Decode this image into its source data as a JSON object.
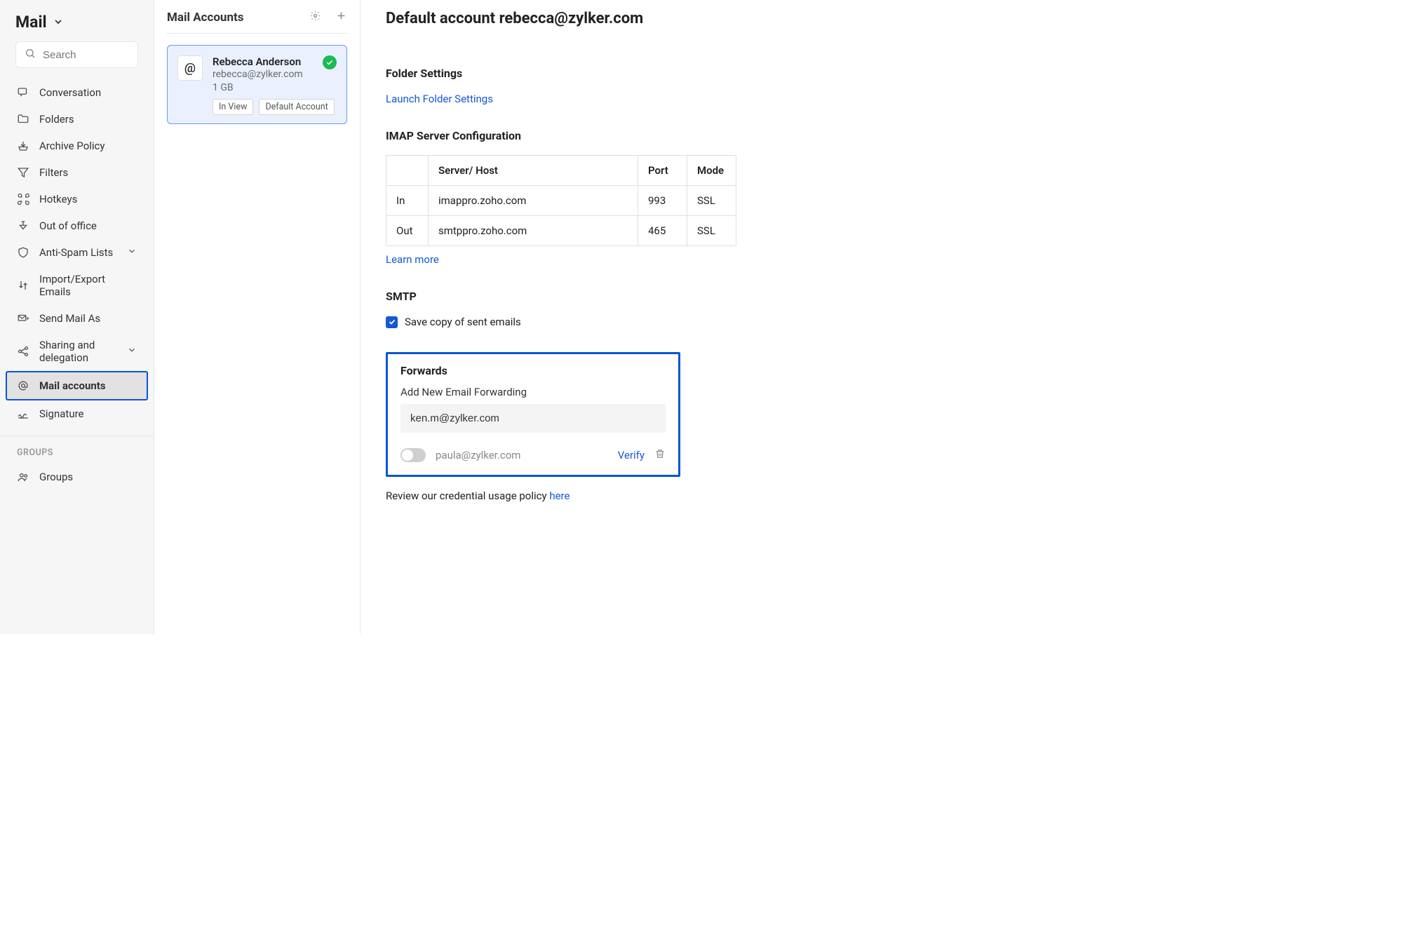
{
  "sidebar": {
    "appTitle": "Mail",
    "searchPlaceholder": "Search",
    "items": [
      {
        "label": "Conversation",
        "icon": "conversation-icon"
      },
      {
        "label": "Folders",
        "icon": "folder-icon"
      },
      {
        "label": "Archive Policy",
        "icon": "archive-icon"
      },
      {
        "label": "Filters",
        "icon": "filter-icon"
      },
      {
        "label": "Hotkeys",
        "icon": "hotkeys-icon"
      },
      {
        "label": "Out of office",
        "icon": "out-of-office-icon"
      },
      {
        "label": "Anti-Spam Lists",
        "icon": "shield-icon",
        "expandable": true
      },
      {
        "label": "Import/Export Emails",
        "icon": "import-export-icon"
      },
      {
        "label": "Send Mail As",
        "icon": "send-as-icon"
      },
      {
        "label": "Sharing and delegation",
        "icon": "share-icon",
        "expandable": true
      },
      {
        "label": "Mail accounts",
        "icon": "at-icon",
        "active": true
      },
      {
        "label": "Signature",
        "icon": "signature-icon"
      }
    ],
    "groupsHeader": "GROUPS",
    "groups": [
      {
        "label": "Groups",
        "icon": "groups-icon"
      }
    ]
  },
  "middle": {
    "title": "Mail Accounts",
    "account": {
      "name": "Rebecca Anderson",
      "email": "rebecca@zylker.com",
      "storage": "1 GB",
      "badges": [
        "In View",
        "Default Account"
      ],
      "verified": true
    }
  },
  "detail": {
    "title": "Default account rebecca@zylker.com",
    "folderSettings": {
      "heading": "Folder Settings",
      "link": "Launch Folder Settings"
    },
    "imap": {
      "heading": "IMAP Server Configuration",
      "headers": [
        "",
        "Server/ Host",
        "Port",
        "Mode"
      ],
      "rows": [
        {
          "dir": "In",
          "host": "imappro.zoho.com",
          "port": "993",
          "mode": "SSL"
        },
        {
          "dir": "Out",
          "host": "smtppro.zoho.com",
          "port": "465",
          "mode": "SSL"
        }
      ],
      "learnMore": "Learn more"
    },
    "smtp": {
      "heading": "SMTP",
      "saveCopy": "Save copy of sent emails",
      "saveCopyChecked": true
    },
    "forwards": {
      "heading": "Forwards",
      "addLabel": "Add New Email Forwarding",
      "inputValue": "ken.m@zylker.com",
      "pending": {
        "email": "paula@zylker.com",
        "enabled": false,
        "verify": "Verify"
      }
    },
    "policy": {
      "text": "Review our credential usage policy ",
      "link": "here"
    }
  }
}
